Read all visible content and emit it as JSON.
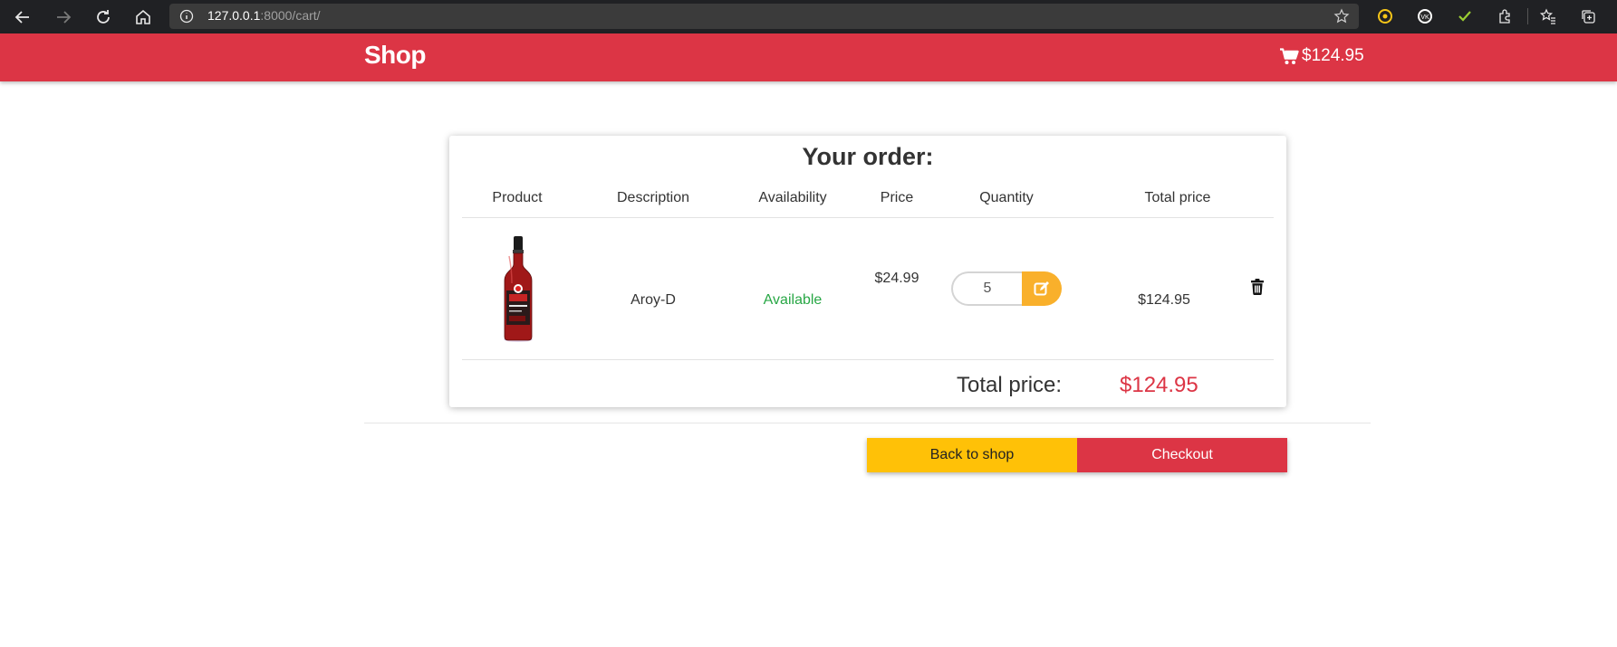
{
  "browser": {
    "url_host": "127.0.0.1",
    "url_rest": ":8000/cart/",
    "icons": [
      "back-arrow-icon",
      "forward-arrow-icon",
      "reload-icon",
      "home-icon",
      "info-icon",
      "add-favorite-icon",
      "extension-icon",
      "collections-icon",
      "favorites-icon"
    ]
  },
  "header": {
    "brand": "Shop",
    "cart_total": "$124.95",
    "cart_icon": "shopping-cart-icon",
    "color": "#dc3545"
  },
  "order": {
    "title": "Your order:",
    "columns": {
      "product": "Product",
      "description": "Description",
      "availability": "Availability",
      "price": "Price",
      "quantity": "Quantity",
      "total_price": "Total price"
    },
    "items": [
      {
        "description": "Aroy-D",
        "availability": "Available",
        "price": "$24.99",
        "quantity": "5",
        "total": "$124.95"
      }
    ],
    "total_label": "Total price:",
    "total_value": "$124.95"
  },
  "actions": {
    "back_label": "Back to shop",
    "checkout_label": "Checkout"
  },
  "colors": {
    "accent_red": "#dc3545",
    "available_green": "#28a745",
    "back_yellow": "#ffc107",
    "update_orange": "#f9b02b"
  }
}
